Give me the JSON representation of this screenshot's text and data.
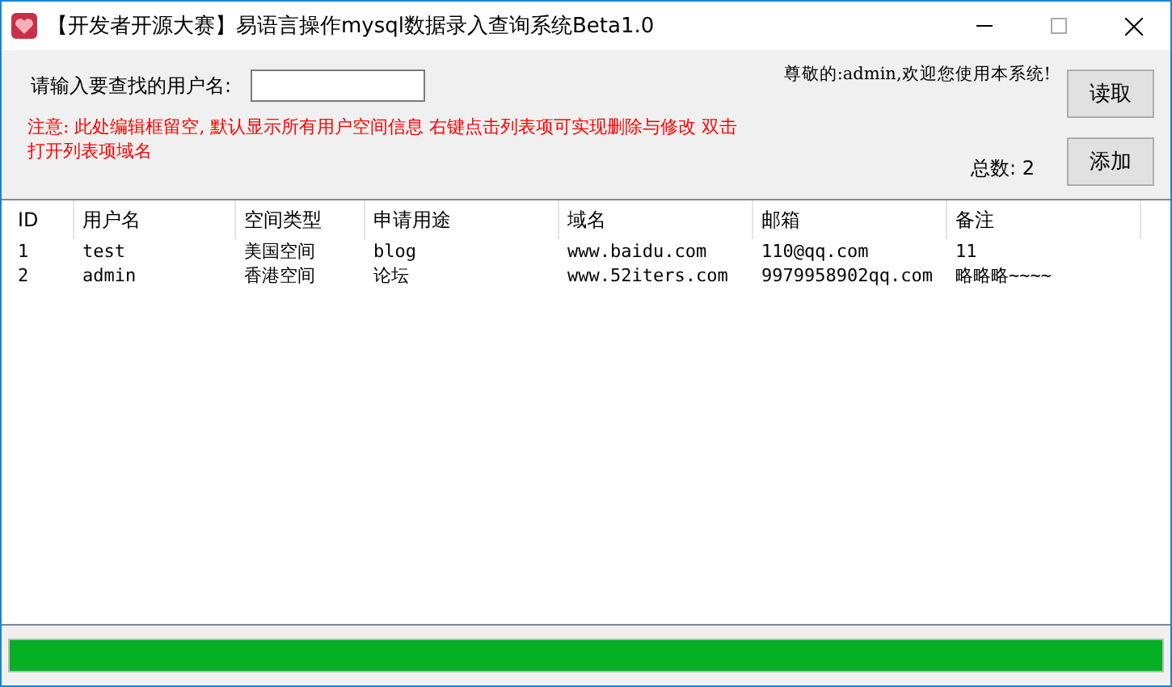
{
  "window": {
    "title": "【开发者开源大赛】易语言操作mysql数据录入查询系统Beta1.0"
  },
  "search": {
    "label": "请输入要查找的用户名:"
  },
  "greeting": "尊敬的:admin,欢迎您使用本系统!",
  "notice": "注意: 此处编辑框留空, 默认显示所有用户空间信息 右键点击列表项可实现删除与修改 双击打开列表项域名",
  "total": "总数: 2",
  "buttons": [
    {
      "label": "读取"
    },
    {
      "label": "添加"
    }
  ],
  "table": {
    "columns": [
      "ID",
      "用户名",
      "空间类型",
      "申请用途",
      "域名",
      "邮箱",
      "备注"
    ],
    "rows": [
      [
        "1",
        "test",
        "美国空间",
        "blog",
        "www.baidu.com",
        "110@qq.com",
        "11"
      ],
      [
        "2",
        "admin",
        "香港空间",
        "论坛",
        "www.52iters.com",
        "9979958902qq.com",
        "略略略~~~~"
      ]
    ]
  },
  "progress": {
    "level": 1
  }
}
